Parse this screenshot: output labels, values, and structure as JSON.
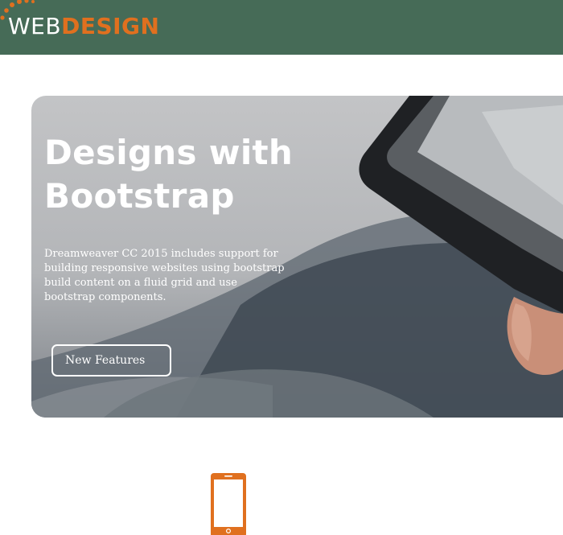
{
  "header": {
    "logo_web": "WEB",
    "logo_design": "DESIGN",
    "accent_color": "#e0701f",
    "bar_color": "#466b57"
  },
  "hero": {
    "title_line1": "Designs with",
    "title_line2": "Bootstrap",
    "description": "Dreamweaver CC 2015 includes support for building responsive websites using bootstrap build content on a fluid grid and use bootstrap components.",
    "button_label": "New Features"
  },
  "features": {
    "icon": "mobile-phone-icon"
  }
}
